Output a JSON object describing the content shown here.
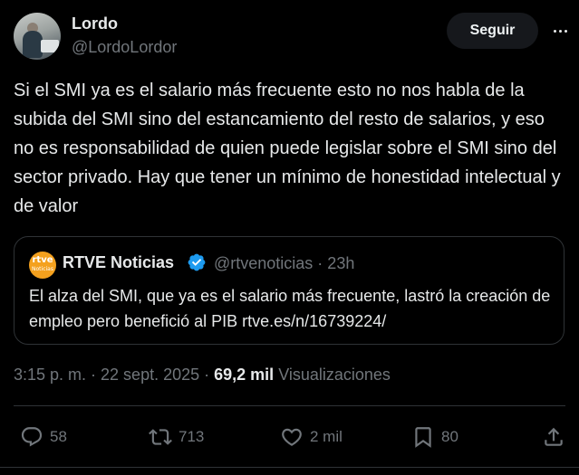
{
  "author": {
    "display_name": "Lordo",
    "handle": "@LordoLordor"
  },
  "follow_label": "Seguir",
  "tweet_text": "Si el SMI ya es el salario más frecuente esto no nos habla de la subida del SMI sino del estancamiento del resto de salarios, y eso no es responsabilidad de quien puede legislar sobre el SMI sino del sector privado. Hay que tener un mínimo de honestidad intelectual y de valor",
  "quoted": {
    "avatar_text": "rtve",
    "avatar_subtext": "Noticias",
    "display_name": "RTVE Noticias",
    "handle_time": "@rtvenoticias · 23h",
    "text": "El alza del SMI, que ya es el salario más frecuente, lastró la creación de empleo pero benefició al PIB rtve.es/n/16739224/"
  },
  "meta": {
    "timestamp": "3:15 p. m. · 22 sept. 2025 · ",
    "views_count": "69,2 mil",
    "views_label": "Visualizaciones"
  },
  "actions": {
    "replies": "58",
    "reposts": "713",
    "likes": "2 mil",
    "bookmarks": "80"
  },
  "colors": {
    "background": "#000000",
    "text": "#e7e9ea",
    "secondary": "#71767b",
    "border": "#2f3336",
    "verified": "#1d9bf0",
    "rtve_orange": "#f4a11e"
  },
  "icons": [
    "more-icon",
    "verified-badge-icon",
    "reply-icon",
    "repost-icon",
    "like-icon",
    "bookmark-icon",
    "share-icon"
  ]
}
